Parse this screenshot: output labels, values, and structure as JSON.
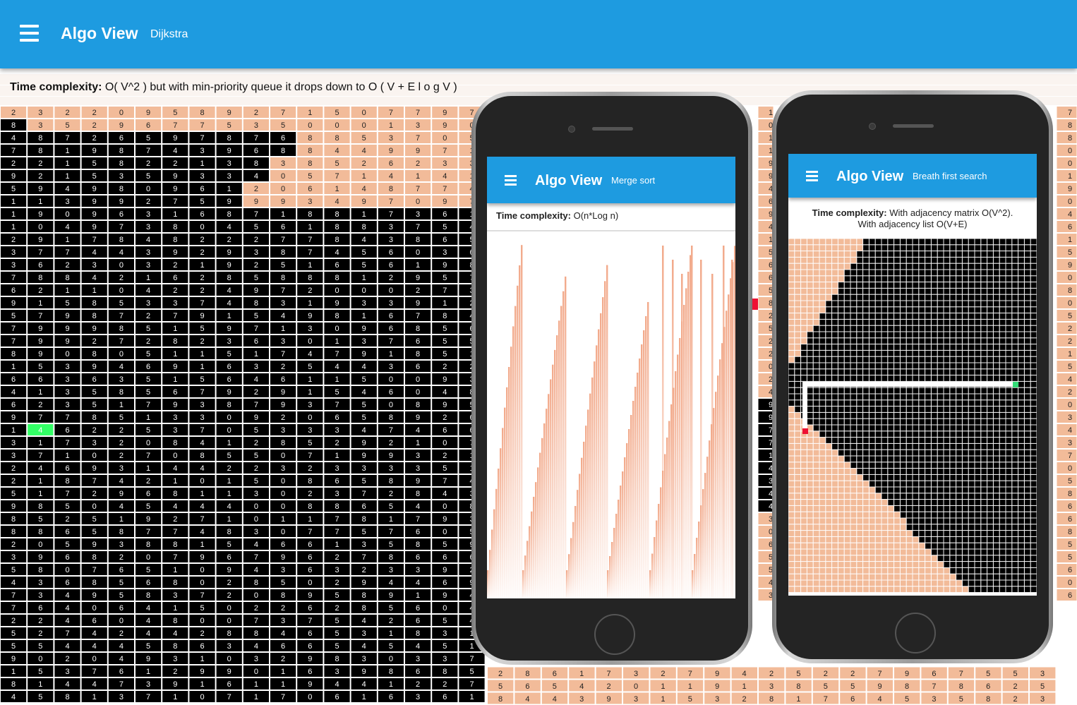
{
  "app": {
    "title": "Algo View",
    "subtitle": "Dijkstra",
    "menu_icon": "hamburger-menu-icon"
  },
  "complexity": {
    "label": "Time complexity:",
    "text": " O( V^2 ) but with min-priority queue it drops down to O ( V + E l o g V )"
  },
  "grid": {
    "visible_rows": [
      "2 3 2 2 0 9 5 8 9 2 7 1 5 0 7 7 9 7",
      "8 3 5 2 9 6 7 7 5 3 5 0 0 0 1 3 9 0",
      "4 8 7 2 6 5 9 7 8 7 6 8 8 5 3 7 0 5",
      "7 8 1 9 8 7 4 3 9 6 8 8 4 4 9 9 7 1",
      "2 2 1 5 8 2 2 1 3 8 3 8 5 2 6 2 3 3",
      "9 2 1 5 3 5 9 3 3 4 0 5 7 1 4 1 4 1",
      "5 9 4 9 8 0 9 6 1 2 0 6 1 4 8 7 7 4",
      "1 1 3 9 9 2 7 5 9 9 9 3 4 9 7 0 9 7",
      "1 9 0 9 6 3 1 6 8 7 1 8 8 1 7 3 6 1",
      "1 0 4 9 7 3 8 0 4 5 6 1 8 8 3 7 5 4",
      "2 9 1 7 8 4 8 2 2 2 7 7 8 4 3 8 6 5",
      "3 7 7 4 4 3 9 2 9 3 8 7 4 5 6 0 3 6",
      "3 6 2 3 0 3 2 1 9 2 5 1 6 5 6 1 9 8",
      "7 8 8 4 2 1 6 2 8 5 8 8 8 1 2 9 5 7",
      "6 2 1 1 0 4 2 2 4 9 7 2 0 0 0 2 7 3",
      "9 1 5 8 5 3 3 7 4 8 3 1 9 3 3 9 1 2",
      "5 7 9 8 7 2 7 9 1 5 4 9 8 1 6 7 8 4",
      "7 9 9 9 8 5 1 5 9 7 1 3 0 9 6 8 5 6",
      "7 9 9 2 7 2 8 2 3 6 3 0 1 3 7 6 5 5",
      "8 9 0 8 0 5 1 1 5 1 7 4 7 9 1 8 5 1",
      "1 5 3 9 4 6 9 1 6 3 2 5 4 4 3 6 2 2",
      "6 6 3 6 3 5 1 5 6 4 6 1 1 5 0 0 9 3",
      "4 1 3 5 8 5 6 7 9 2 9 1 5 4 6 0 4 8",
      "6 2 3 5 1 7 9 3 8 7 9 3 7 5 0 8 9 5",
      "9 7 7 8 5 1 3 3 0 9 2 0 6 5 8 9 2 6",
      "1 4 6 2 2 5 3 7 0 5 3 3 3 4 7 4 6 6",
      "3 1 7 3 2 0 8 4 1 2 8 5 2 9 2 1 0 7",
      "3 7 1 0 2 7 0 8 5 5 0 7 1 9 9 3 2 1",
      "2 4 6 9 3 1 4 4 2 2 3 2 3 3 3 3 5 1",
      "2 1 8 7 4 2 1 0 1 5 0 8 6 5 8 9 7 4",
      "5 1 7 2 9 6 8 1 1 3 0 2 3 7 2 8 4 3",
      "9 8 5 0 4 5 4 4 4 0 0 8 8 6 5 4 0 8",
      "8 5 2 5 1 9 2 7 1 0 1 1 7 8 1 7 9 3",
      "8 8 6 5 8 7 7 4 8 3 0 7 7 5 7 6 0 5",
      "2 0 5 9 3 8 8 1 5 4 6 6 1 3 5 8 5 9",
      "3 9 6 8 2 0 7 9 6 7 9 6 2 7 8 6 6 6",
      "5 8 0 7 6 5 1 0 9 4 3 6 3 2 3 3 9 2",
      "4 3 6 8 5 6 8 0 2 8 5 0 2 9 4 4 6 9",
      "7 3 4 9 5 8 3 7 2 0 8 9 5 8 9 1 9 4",
      "7 6 4 0 6 4 1 5 0 2 2 6 2 8 5 6 0 4",
      "2 2 4 6 0 4 8 0 0 7 3 7 5 4 2 6 5 4",
      "5 2 7 4 2 4 4 2 8 8 4 6 5 3 1 8 3 1",
      "5 5 4 4 4 5 8 6 3 4 6 6 5 4 5 4 5 1",
      "9 0 2 0 4 9 3 1 0 3 2 9 8 3 0 3 3 7",
      "1 5 3 7 6 1 2 9 9 0 1 6 3 9 8 6 8 5",
      "8 1 4 4 7 3 9 1 6 1 1 9 4 4 1 2 2 7",
      "4 5 8 1 3 7 1 0 7 1 7 0 6 1 6 3 6 1"
    ],
    "bottom_strip_rows": [
      "2 8 6 1 7 3 2 7 9 4 2 5 2 2 7 9 6 7 5 5 3 3 5 5 6 6",
      "5 6 5 4 2 0 1 1 9 1 3 8 5 5 9 8 7 8 6 2 5 6 8 1 3 5",
      "8 4 4 3 9 3 1 5 3 2 8 1 7 6 4 5 3 5 8 2 3 1 4 7 1 6"
    ],
    "right_edge_column": "7 8 8 0 0 1 9 0 4 6 1 5 9 0 8 0 5 2 2 1 5 4 2 0 3 4 3 7 0 5 8 6 6 8 5 5 6 0 6",
    "partial_column_between_phones": "1 0 1 1 9 9 4 6 9 4 1 5 6 6 5 8 2 5 2 2 0 2 4 9 9 7 7 1 4 3 4 4 3 0 6 5 5 4 3",
    "dark_grid_color": "#000000",
    "visited_color": "#f2bb99",
    "current_color": "#33ff66",
    "target_color": "#ee1133"
  },
  "phone_merge": {
    "title": "Algo View",
    "subtitle": "Merge sort",
    "complexity_label": "Time complexity:",
    "complexity_text": " O(n*Log n)",
    "bar_color": "#f2a98a"
  },
  "phone_bfs": {
    "title": "Algo View",
    "subtitle": "Breath first search",
    "complexity_label": "Time complexity:",
    "complexity_text": " With adjacency matrix O(V^2).",
    "complexity_text_2": "With adjacency list O(V+E)"
  }
}
